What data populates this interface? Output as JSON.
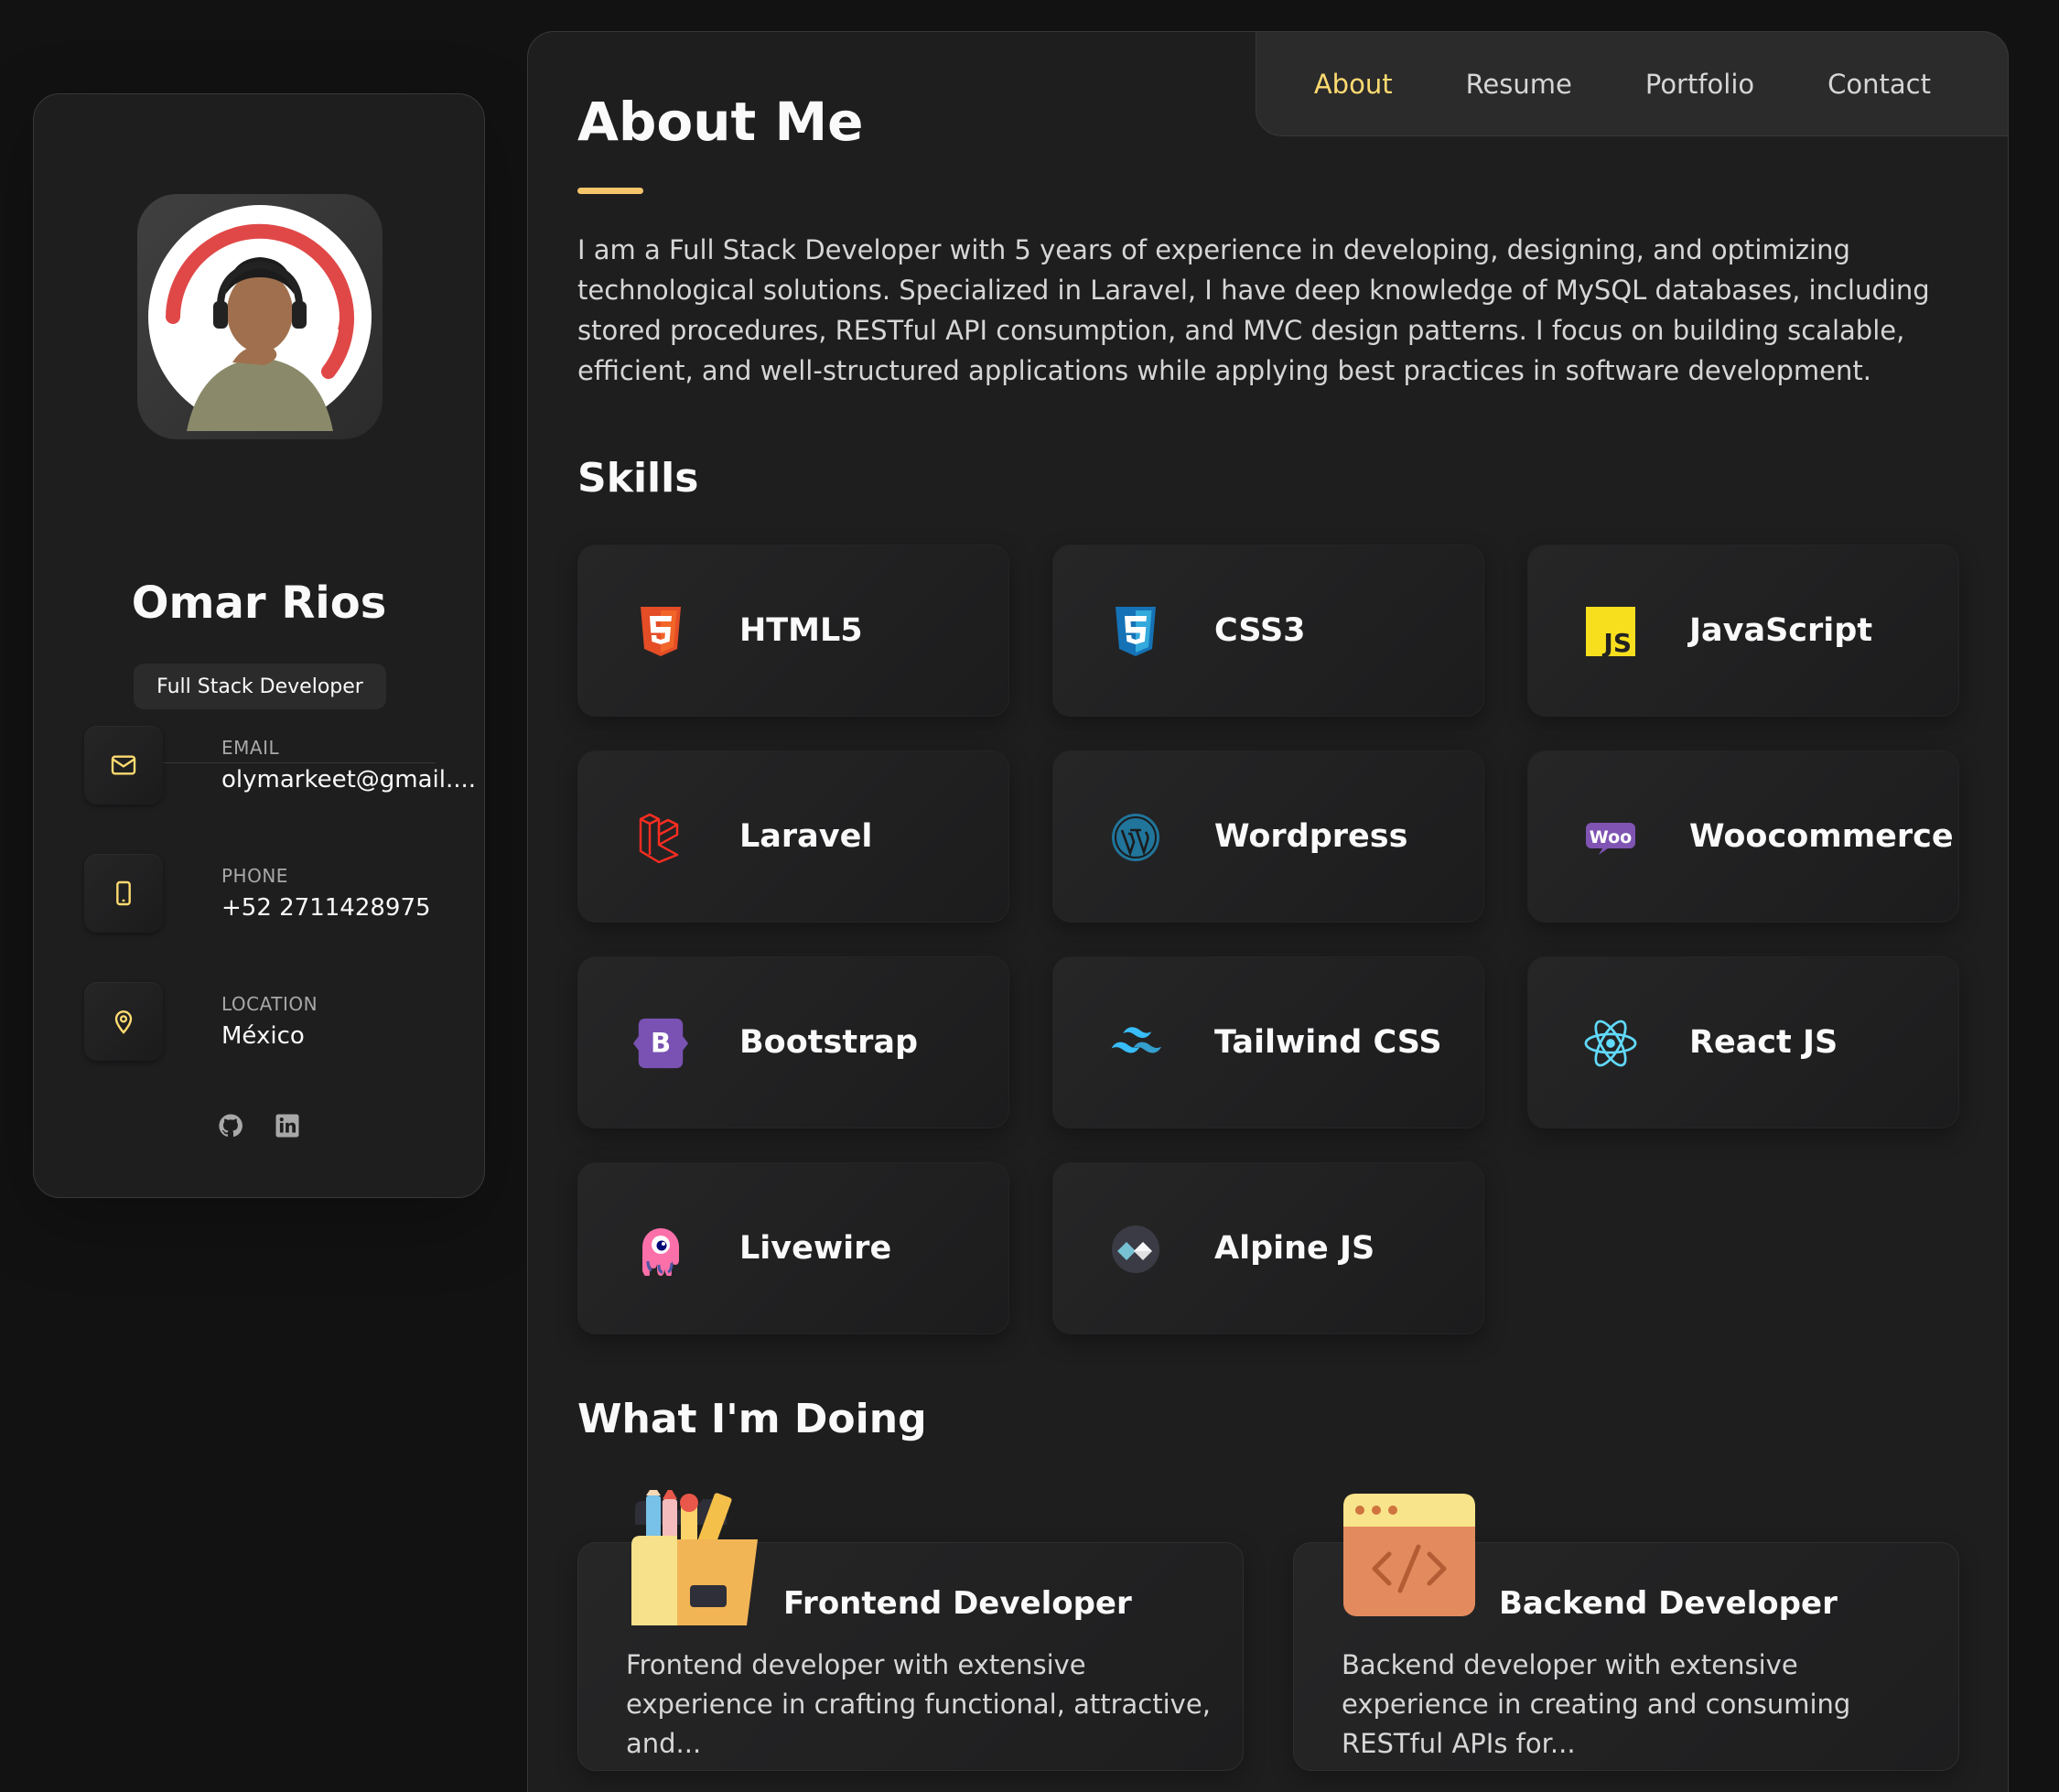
{
  "profile": {
    "name": "Omar Rios",
    "title": "Full Stack Developer"
  },
  "contacts": [
    {
      "label": "EMAIL",
      "value": "olymarkeet@gmail....",
      "icon": "mail-icon"
    },
    {
      "label": "PHONE",
      "value": "+52 2711428975",
      "icon": "phone-icon"
    },
    {
      "label": "LOCATION",
      "value": "México",
      "icon": "location-icon"
    }
  ],
  "socials": [
    {
      "icon": "github-icon"
    },
    {
      "icon": "linkedin-icon"
    }
  ],
  "nav": {
    "items": [
      "About",
      "Resume",
      "Portfolio",
      "Contact"
    ],
    "active": "About",
    "active_color": "#ffdb70"
  },
  "about": {
    "title": "About Me",
    "text": "I am a Full Stack Developer with 5 years of experience in developing, designing, and optimizing technological solutions. Specialized in Laravel, I have deep knowledge of MySQL databases, including stored procedures, RESTful API consumption, and MVC design patterns. I focus on building scalable, efficient, and well-structured applications while applying best practices in software development."
  },
  "skills": {
    "title": "Skills",
    "items": [
      {
        "label": "HTML5",
        "icon": "html5-icon"
      },
      {
        "label": "CSS3",
        "icon": "css3-icon"
      },
      {
        "label": "JavaScript",
        "icon": "javascript-icon"
      },
      {
        "label": "Laravel",
        "icon": "laravel-icon"
      },
      {
        "label": "Wordpress",
        "icon": "wordpress-icon"
      },
      {
        "label": "Woocommerce",
        "icon": "woocommerce-icon"
      },
      {
        "label": "Bootstrap",
        "icon": "bootstrap-icon"
      },
      {
        "label": "Tailwind CSS",
        "icon": "tailwind-icon"
      },
      {
        "label": "React JS",
        "icon": "react-icon"
      },
      {
        "label": "Livewire",
        "icon": "livewire-icon"
      },
      {
        "label": "Alpine JS",
        "icon": "alpine-icon"
      }
    ]
  },
  "doing": {
    "title": "What I'm Doing",
    "items": [
      {
        "title": "Frontend Developer",
        "text": "Frontend developer with extensive experience in crafting functional, attractive, and...",
        "icon": "design-folder-icon"
      },
      {
        "title": "Backend Developer",
        "text": "Backend developer with extensive experience in creating and consuming RESTful APIs for...",
        "icon": "code-window-icon"
      }
    ]
  }
}
